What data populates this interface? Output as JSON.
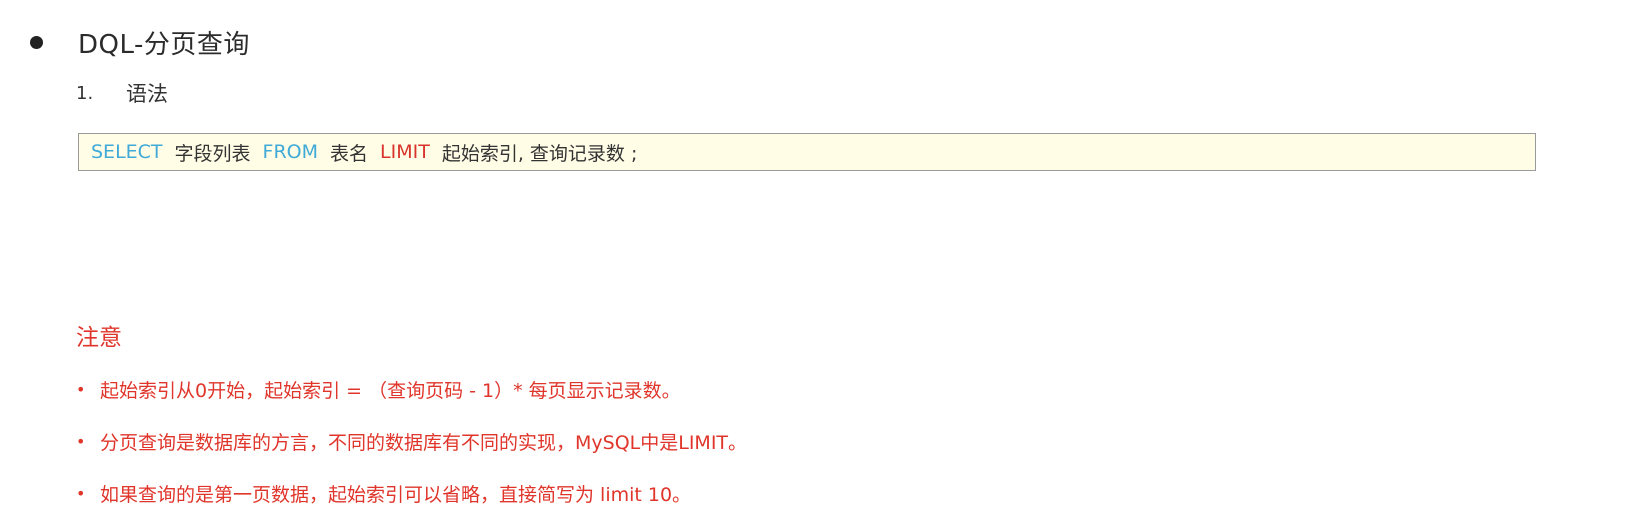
{
  "heading": {
    "bullet": "●",
    "title": "DQL-分页查询"
  },
  "step": {
    "number": "1.",
    "label": "语法"
  },
  "code": {
    "select_kw": "SELECT",
    "fields": "字段列表",
    "from_kw": "FROM",
    "table": "表名",
    "limit_kw": "LIMIT",
    "args": "起始索引, 查询记录数 ;",
    "colors": {
      "keyword_blue": "#3fa9d8",
      "keyword_red": "#d9342b",
      "box_background": "#fffde6"
    }
  },
  "note": {
    "title": "注意",
    "bullet": "•",
    "items": [
      "起始索引从0开始，起始索引 = （查询页码 - 1）* 每页显示记录数。",
      "分页查询是数据库的方言，不同的数据库有不同的实现，MySQL中是LIMIT。",
      "如果查询的是第一页数据，起始索引可以省略，直接简写为 limit 10。"
    ],
    "color": "#e0352b"
  }
}
